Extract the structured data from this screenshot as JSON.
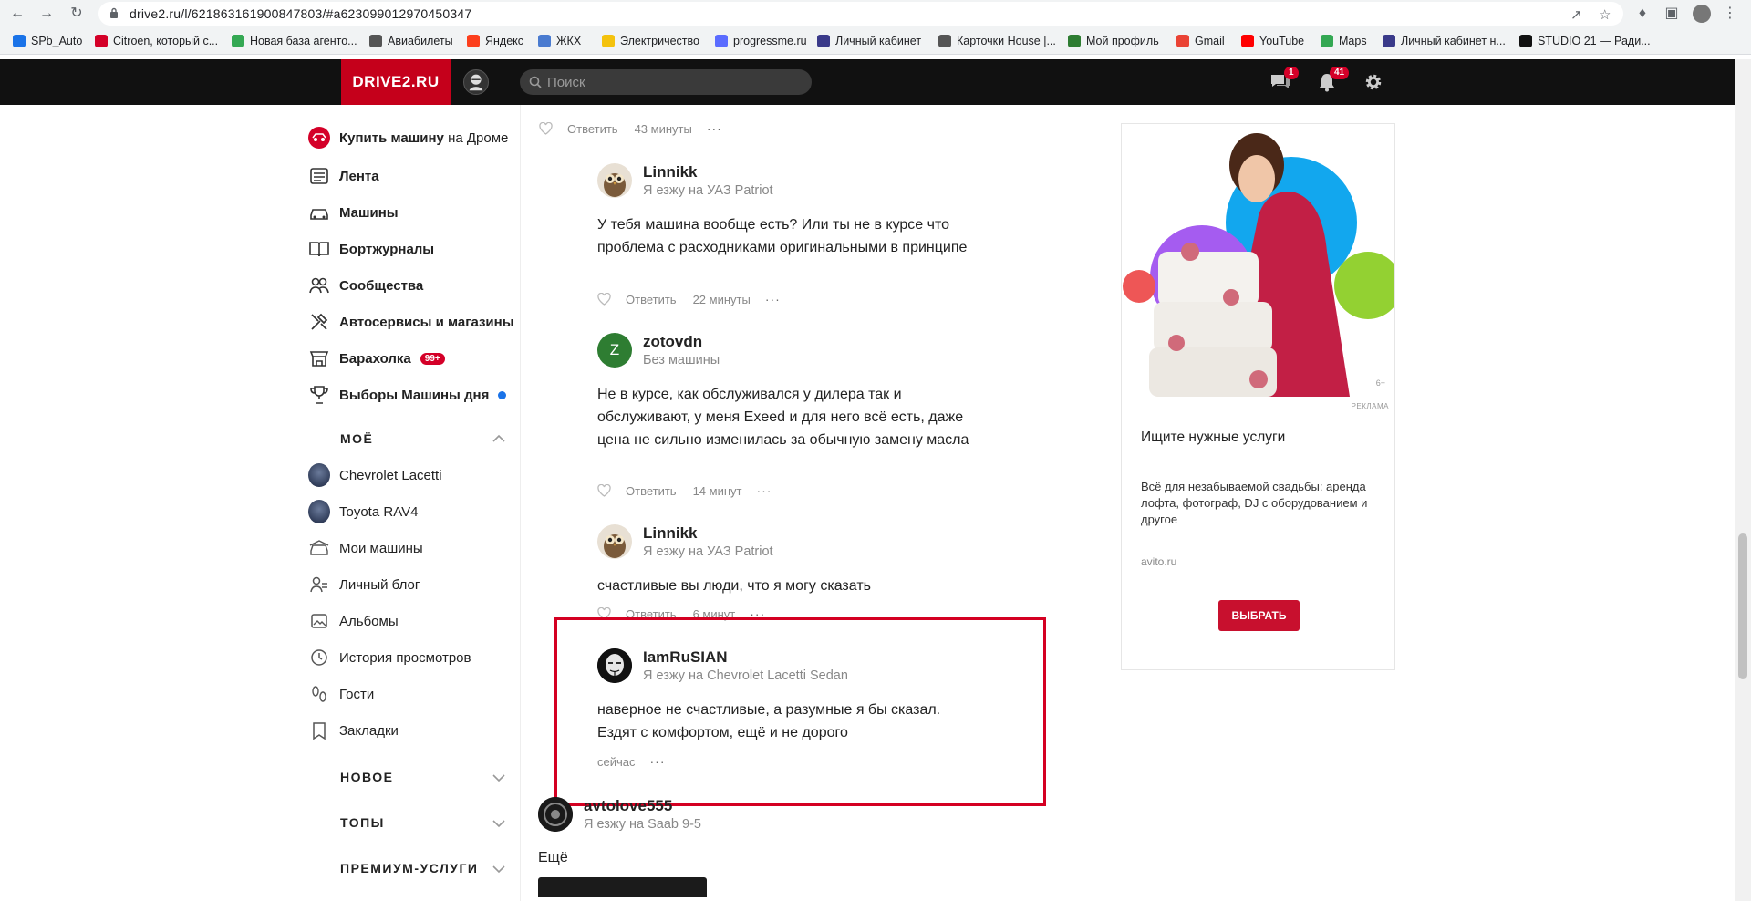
{
  "browser": {
    "url": "drive2.ru/l/621863161900847803/#a623099012970450347",
    "bookmarks": [
      {
        "label": "SPb_Auto",
        "color": "#1a73e8"
      },
      {
        "label": "Citroen, который с...",
        "color": "#d40028"
      },
      {
        "label": "Новая база агенто...",
        "color": "#34a853"
      },
      {
        "label": "Авиабилеты",
        "color": "#555555"
      },
      {
        "label": "Яндекс",
        "color": "#fc3f1d"
      },
      {
        "label": "ЖКХ",
        "color": "#4a7bd0"
      },
      {
        "label": "Электричество",
        "color": "#f4c20d"
      },
      {
        "label": "progressme.ru",
        "color": "#5b6cff"
      },
      {
        "label": "Личный кабинет",
        "color": "#3a3a8a"
      },
      {
        "label": "Карточки House |...",
        "color": "#555555"
      },
      {
        "label": "Мой профиль",
        "color": "#2e7d32"
      },
      {
        "label": "Gmail",
        "color": "#ea4335"
      },
      {
        "label": "YouTube",
        "color": "#ff0000"
      },
      {
        "label": "Maps",
        "color": "#34a853"
      },
      {
        "label": "Личный кабинет н...",
        "color": "#3a3a8a"
      },
      {
        "label": "STUDIO 21 — Ради...",
        "color": "#111111"
      }
    ]
  },
  "topbar": {
    "logo": "DRIVE2.RU",
    "search_placeholder": "Поиск",
    "messages_badge": "1",
    "notifications_badge": "41"
  },
  "sidebar": {
    "buy_car": "Купить машину",
    "buy_car_suffix": "на Дроме",
    "items": [
      {
        "label": "Лента",
        "icon": "feed-icon"
      },
      {
        "label": "Машины",
        "icon": "car-icon"
      },
      {
        "label": "Бортжурналы",
        "icon": "book-icon"
      },
      {
        "label": "Сообщества",
        "icon": "people-icon"
      },
      {
        "label": "Автосервисы и магазины",
        "icon": "tools-icon"
      },
      {
        "label": "Барахолка",
        "icon": "shop-icon",
        "badge": "99+"
      },
      {
        "label": "Выборы Машины дня",
        "icon": "trophy-icon"
      }
    ],
    "mine_header": "МОЁ",
    "mine_items": [
      {
        "label": "Chevrolet Lacetti"
      },
      {
        "label": "Toyota RAV4"
      },
      {
        "label": "Мои машины"
      },
      {
        "label": "Личный блог"
      },
      {
        "label": "Альбомы"
      },
      {
        "label": "История просмотров"
      },
      {
        "label": "Гости"
      },
      {
        "label": "Закладки"
      }
    ],
    "new_header": "НОВОЕ",
    "tops_header": "ТОПЫ",
    "premium_header": "ПРЕМИУМ-УСЛУГИ"
  },
  "comments": {
    "top_actions": {
      "reply": "Ответить",
      "time": "43 минуты"
    },
    "list": [
      {
        "name": "Linnikk",
        "sub": "Я езжу на УАЗ Patriot",
        "text": "У тебя машина вообще есть? Или ты не в курсе что проблема с расходниками оригинальными в принципе",
        "reply": "Ответить",
        "time": "22 минуты"
      },
      {
        "name": "zotovdn",
        "avatar_letter": "Z",
        "sub": "Без машины",
        "text": "Не в курсе, как обслуживался у дилера так и обслуживают, у меня Exeed и для него всё есть, даже цена не сильно изменилась за обычную замену масла",
        "reply": "Ответить",
        "time": "14 минут"
      },
      {
        "name": "Linnikk",
        "sub": "Я езжу на УАЗ Patriot",
        "text": "счастливые вы люди, что я могу сказать",
        "reply": "Ответить",
        "time": "6 минут"
      },
      {
        "name": "IamRuSIAN",
        "sub": "Я езжу на Chevrolet Lacetti Sedan",
        "text": "наверное не счастливые, а разумные я бы сказал. Ездят с комфортом, ещё и не дорого",
        "time": "сейчас"
      }
    ],
    "next": {
      "name": "avtolove555",
      "sub": "Я езжу на Saab 9-5",
      "text": "Ещё"
    }
  },
  "ad": {
    "age": "6+",
    "label": "РЕКЛАМА",
    "title": "Ищите нужные услуги",
    "description": "Всё для незабываемой свадьбы: аренда лофта, фотограф, DJ с оборудованием и другое",
    "domain": "avito.ru",
    "button": "ВЫБРАТЬ"
  },
  "colors": {
    "brand": "#c5001b",
    "accent_red": "#d40028",
    "topbar": "#111111"
  }
}
